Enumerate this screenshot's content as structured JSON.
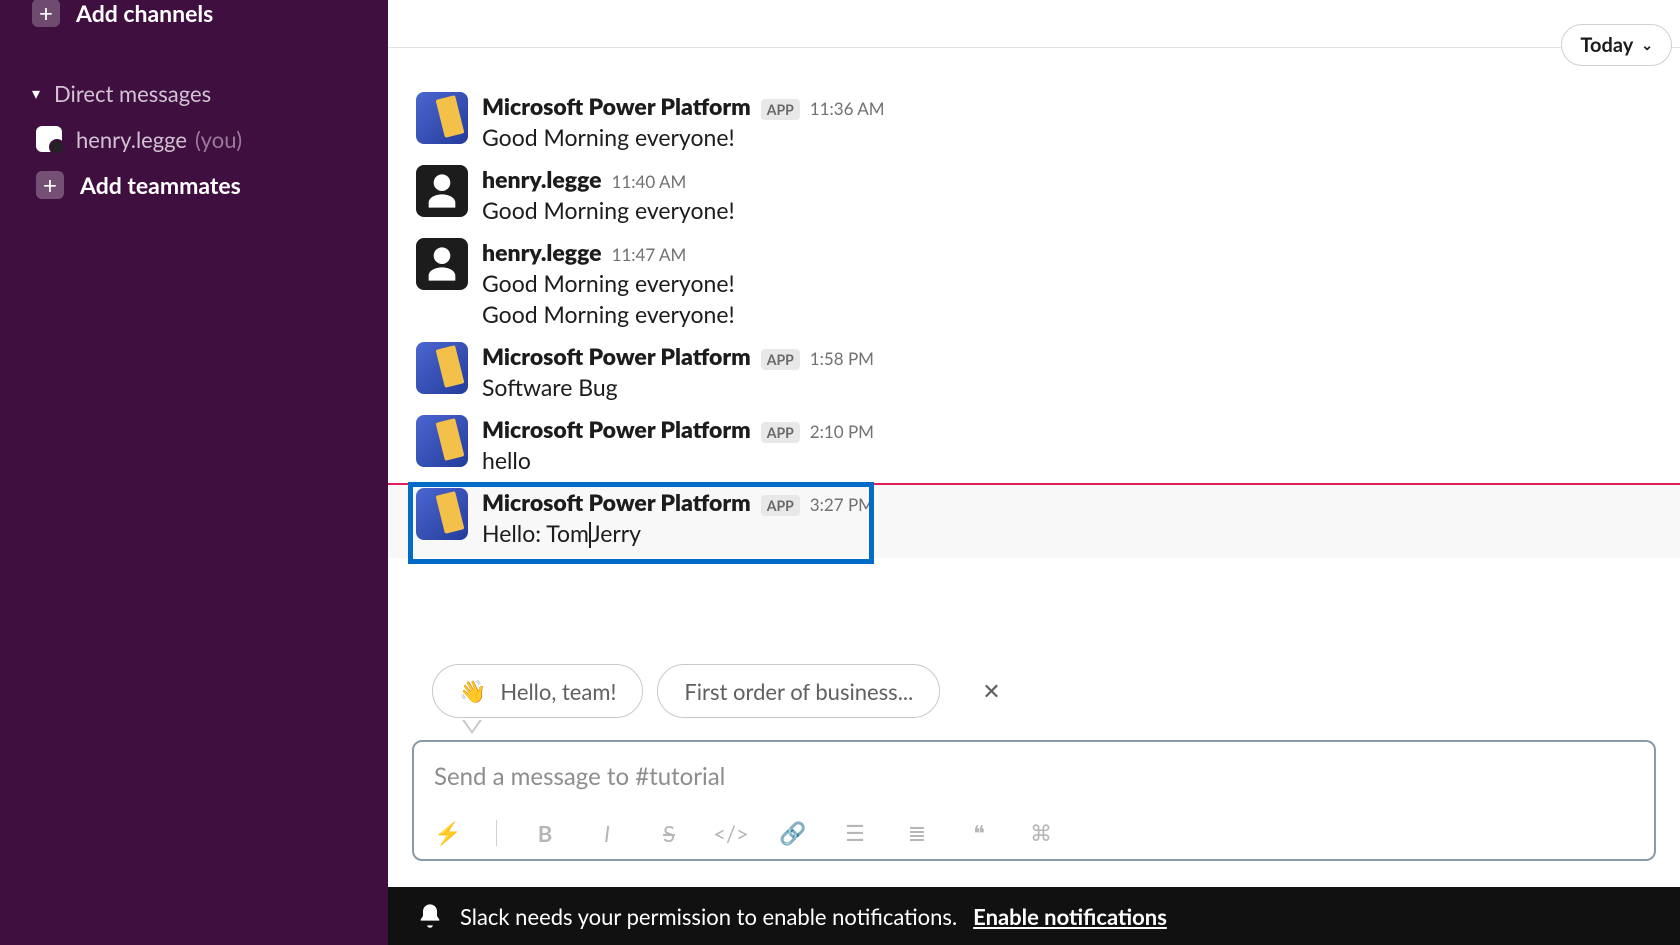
{
  "sidebar": {
    "add_channels": "Add channels",
    "dm_header": "Direct messages",
    "self_name": "henry.legge",
    "self_you": "(you)",
    "add_teammates": "Add teammates"
  },
  "divider": {
    "label": "Today"
  },
  "messages": [
    {
      "sender": "Microsoft Power Platform",
      "is_app": true,
      "time": "11:36 AM",
      "lines": [
        "Good Morning everyone!"
      ]
    },
    {
      "sender": "henry.legge",
      "is_app": false,
      "time": "11:40 AM",
      "lines": [
        "Good Morning everyone!"
      ]
    },
    {
      "sender": "henry.legge",
      "is_app": false,
      "time": "11:47 AM",
      "lines": [
        "Good Morning everyone!",
        "Good Morning everyone!"
      ]
    },
    {
      "sender": "Microsoft Power Platform",
      "is_app": true,
      "time": "1:58 PM",
      "lines": [
        "Software Bug"
      ]
    },
    {
      "sender": "Microsoft Power Platform",
      "is_app": true,
      "time": "2:10 PM",
      "lines": [
        "hello"
      ]
    },
    {
      "sender": "Microsoft Power Platform",
      "is_app": true,
      "time": "3:27 PM",
      "lines": [
        "Hello: TomJerry"
      ],
      "highlighted": true,
      "hovered": true
    }
  ],
  "app_badge": "APP",
  "chips": [
    {
      "emoji": "👋",
      "label": "Hello, team!"
    },
    {
      "emoji": "",
      "label": "First order of business..."
    }
  ],
  "composer": {
    "placeholder": "Send a message to #tutorial"
  },
  "toolbar_icons": [
    "bolt",
    "bold",
    "italic",
    "strike",
    "code",
    "link",
    "olist",
    "ulist",
    "quote",
    "codeblock"
  ],
  "notification": {
    "text": "Slack needs your permission to enable notifications.",
    "link": "Enable notifications"
  },
  "colors": {
    "sidebar": "#3f0f3f",
    "highlight": "#006cc7",
    "redline": "#e01e5a"
  }
}
